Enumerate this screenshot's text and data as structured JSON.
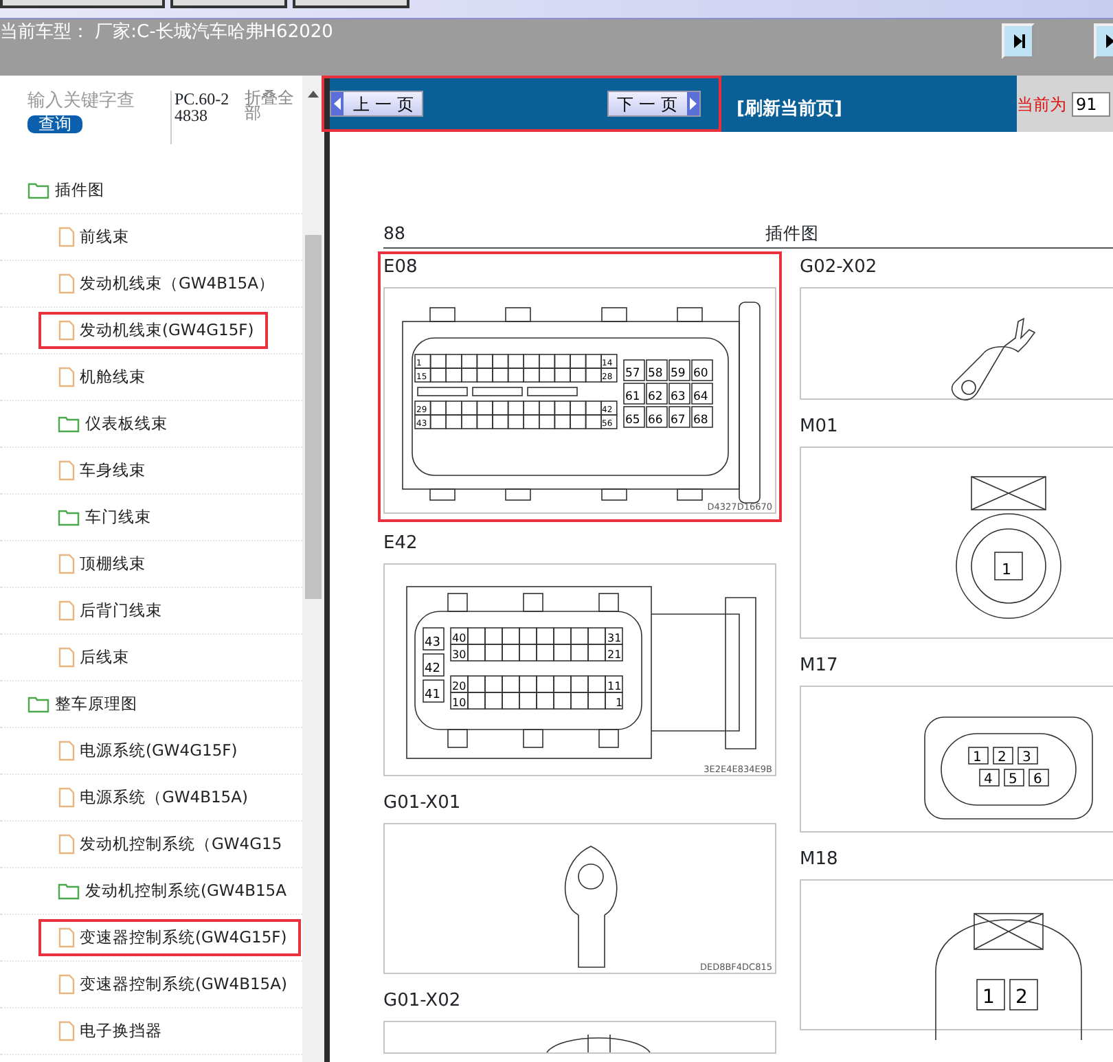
{
  "toolbar": {
    "buttons": [
      {
        "kind": "blank"
      },
      {
        "kind": "blank"
      },
      {
        "kind": "blank"
      }
    ]
  },
  "title_bar": {
    "vehicle_label": "当前车型：",
    "vehicle": "厂家:C-长城汽车哈弗H62020",
    "buttons": [
      {
        "kind": "next"
      },
      {
        "kind": "next"
      }
    ]
  },
  "sidebar": {
    "search": {
      "placeholder": "输入关键字查"
    },
    "search_button": "查询",
    "code": "PC.60-24838",
    "collapse_all": "折叠全部",
    "tree": [
      {
        "label": "插件图",
        "kind": "folder",
        "highlighted": false,
        "children": [
          {
            "label": "前线束",
            "kind": "file",
            "highlighted": false
          },
          {
            "label": "发动机线束（GW4B15A）",
            "kind": "file",
            "highlighted": false
          },
          {
            "label": "发动机线束(GW4G15F)",
            "kind": "file",
            "highlighted": true
          },
          {
            "label": "机舱线束",
            "kind": "file",
            "highlighted": false
          },
          {
            "label": "仪表板线束",
            "kind": "folder",
            "highlighted": false
          },
          {
            "label": "车身线束",
            "kind": "file",
            "highlighted": false
          },
          {
            "label": "车门线束",
            "kind": "folder",
            "highlighted": false
          },
          {
            "label": "顶棚线束",
            "kind": "file",
            "highlighted": false
          },
          {
            "label": "后背门线束",
            "kind": "file",
            "highlighted": false
          },
          {
            "label": "后线束",
            "kind": "file",
            "highlighted": false
          }
        ]
      },
      {
        "label": "整车原理图",
        "kind": "folder",
        "highlighted": false,
        "children": [
          {
            "label": "电源系统(GW4G15F)",
            "kind": "file",
            "highlighted": false
          },
          {
            "label": "电源系统（GW4B15A)",
            "kind": "file",
            "highlighted": false
          },
          {
            "label": "发动机控制系统（GW4G15",
            "kind": "file",
            "highlighted": false
          },
          {
            "label": "发动机控制系统(GW4B15A",
            "kind": "folder",
            "highlighted": false
          },
          {
            "label": "变速器控制系统(GW4G15F)",
            "kind": "file",
            "highlighted": true
          },
          {
            "label": "变速器控制系统(GW4B15A)",
            "kind": "file",
            "highlighted": false
          },
          {
            "label": "电子换挡器",
            "kind": "file",
            "highlighted": false
          }
        ]
      }
    ]
  },
  "nav": {
    "prev": "上一页",
    "next": "下一页",
    "highlighted": true,
    "refresh": "[刷新当前页]",
    "current_label": "当前为",
    "current_page": "91"
  },
  "document": {
    "page_number": "88",
    "section": "插件图",
    "columns": [
      [
        {
          "name": "E08",
          "kind": "ecu",
          "code": "D4327D16670",
          "highlighted": true,
          "pins": [
            "1",
            "14",
            "15",
            "28",
            "29",
            "42",
            "43",
            "56",
            "57",
            "58",
            "59",
            "60",
            "61",
            "62",
            "63",
            "64",
            "65",
            "66",
            "67",
            "68"
          ]
        },
        {
          "name": "E42",
          "kind": "rect",
          "code": "3E2E4E834E9B",
          "highlighted": false,
          "pins": [
            "43",
            "42",
            "41",
            "40",
            "31",
            "30",
            "21",
            "20",
            "11",
            "10",
            "1"
          ]
        },
        {
          "name": "G01-X01",
          "kind": "ring",
          "code": "DED8BF4DC815",
          "highlighted": false
        },
        {
          "name": "G01-X02",
          "kind": "partial",
          "highlighted": false
        }
      ],
      [
        {
          "name": "G02-X02",
          "kind": "fork",
          "highlighted": false
        },
        {
          "name": "M01",
          "kind": "round1",
          "highlighted": false,
          "pins": [
            "1"
          ]
        },
        {
          "name": "M17",
          "kind": "oval6",
          "highlighted": false,
          "pins": [
            "1",
            "2",
            "3",
            "4",
            "5",
            "6"
          ]
        },
        {
          "name": "M18",
          "kind": "round2",
          "highlighted": false,
          "pins": [
            "1",
            "2"
          ]
        }
      ]
    ]
  }
}
